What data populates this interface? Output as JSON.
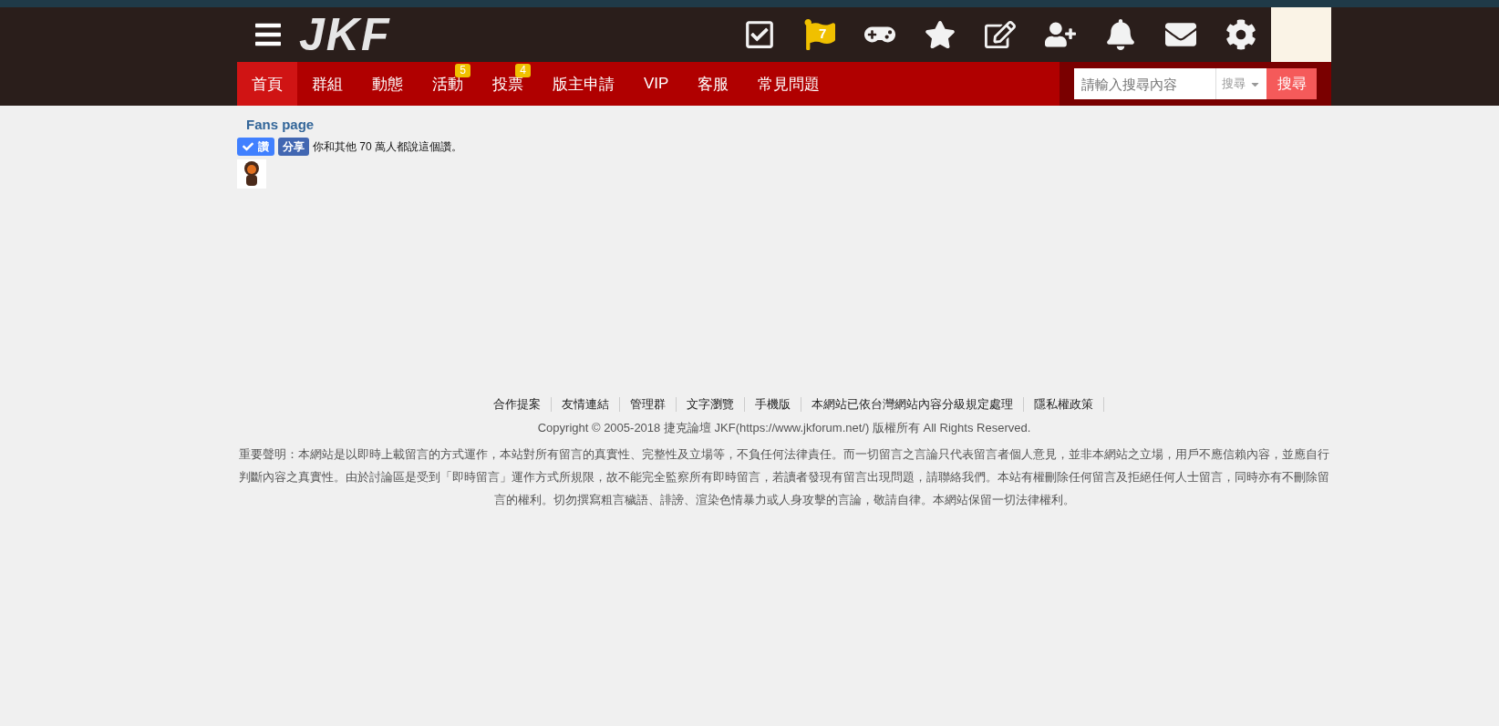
{
  "header": {
    "logo": "JKF",
    "icons": [
      {
        "kind": "tasks"
      },
      {
        "kind": "flag",
        "badge": "7"
      },
      {
        "kind": "games"
      },
      {
        "kind": "favorites"
      },
      {
        "kind": "post"
      },
      {
        "kind": "friends"
      },
      {
        "kind": "notifications"
      },
      {
        "kind": "messages"
      },
      {
        "kind": "settings"
      }
    ]
  },
  "nav": {
    "tabs": [
      {
        "label": "首頁",
        "selected": true
      },
      {
        "label": "群組",
        "selected": false
      },
      {
        "label": "動態",
        "selected": false
      },
      {
        "label": "活動",
        "selected": false,
        "badge": "5"
      },
      {
        "label": "投票",
        "selected": false,
        "badge": "4"
      },
      {
        "label": "版主申請",
        "selected": false
      },
      {
        "label": "VIP",
        "selected": false
      },
      {
        "label": "客服",
        "selected": false
      },
      {
        "label": "常見問題",
        "selected": false
      }
    ],
    "search": {
      "placeholder": "請輸入搜尋內容",
      "scope": "搜尋",
      "button": "搜尋"
    }
  },
  "fans": {
    "title": "Fans page",
    "like_button": "讚",
    "share_button": "分享",
    "like_text": "你和其他 70 萬人都說這個讚。"
  },
  "footer": {
    "links": [
      "合作提案",
      "友情連結",
      "管理群",
      "文字瀏覽",
      "手機版",
      "本網站已依台灣網站內容分級規定處理",
      "隱私權政策"
    ],
    "copyright": "Copyright © 2005-2018 捷克論壇 JKF(https://www.jkforum.net/) 版權所有 All Rights Reserved.",
    "disclaimer": "重要聲明：本網站是以即時上載留言的方式運作，本站對所有留言的真實性、完整性及立場等，不負任何法律責任。而一切留言之言論只代表留言者個人意見，並非本網站之立場，用戶不應信賴內容，並應自行判斷內容之真實性。由於討論區是受到「即時留言」運作方式所規限，故不能完全監察所有即時留言，若讀者發現有留言出現問題，請聯絡我們。本站有權刪除任何留言及拒絕任何人士留言，同時亦有不刪除留言的權利。切勿撰寫粗言穢語、誹謗、渲染色情暴力或人身攻擊的言論，敬請自律。本網站保留一切法律權利。"
  }
}
